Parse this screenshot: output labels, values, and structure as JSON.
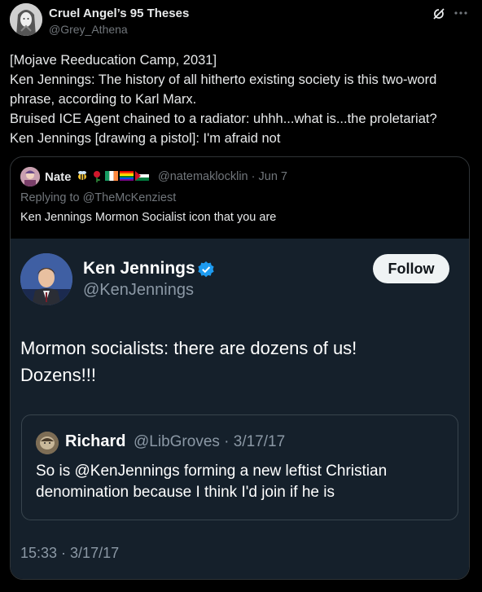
{
  "post": {
    "author_name": "Cruel Angel’s 95 Theses",
    "author_handle": "@Grey_Athena",
    "lines": [
      "[Mojave Reeducation Camp, 2031]",
      "Ken Jennings: The history of all hitherto existing society is this two-word phrase, according to Karl Marx.",
      "Bruised ICE Agent chained to a radiator: uhhh...what is...the proletariat?",
      "Ken Jennings [drawing a pistol]: I'm afraid not"
    ],
    "icons": {
      "grok": "grok-icon",
      "more": "more-icon"
    }
  },
  "quote": {
    "author_name": "Nate",
    "emojis": [
      "bee",
      "rose",
      "ireland-flag",
      "rainbow-flag",
      "palestine-flag"
    ],
    "meta": "@natemaklocklin · Jun 7",
    "replying_to": "Replying to @TheMcKenziest",
    "text": "Ken Jennings Mormon Socialist icon that you are"
  },
  "screenshot": {
    "name": "Ken Jennings",
    "handle": "@KenJennings",
    "follow_label": "Follow",
    "text_lines": [
      "Mormon socialists: there are dozens of us!",
      "Dozens!!!"
    ],
    "inner_quote": {
      "name": "Richard",
      "meta": "@LibGroves · 3/17/17",
      "text": "So is @KenJennings forming a new leftist Christian denomination because I think I'd join if he is"
    },
    "timestamp": "15:33 · 3/17/17",
    "colors": {
      "background": "#15202b",
      "verified": "#1d9bf0",
      "muted": "#8b98a5"
    }
  }
}
